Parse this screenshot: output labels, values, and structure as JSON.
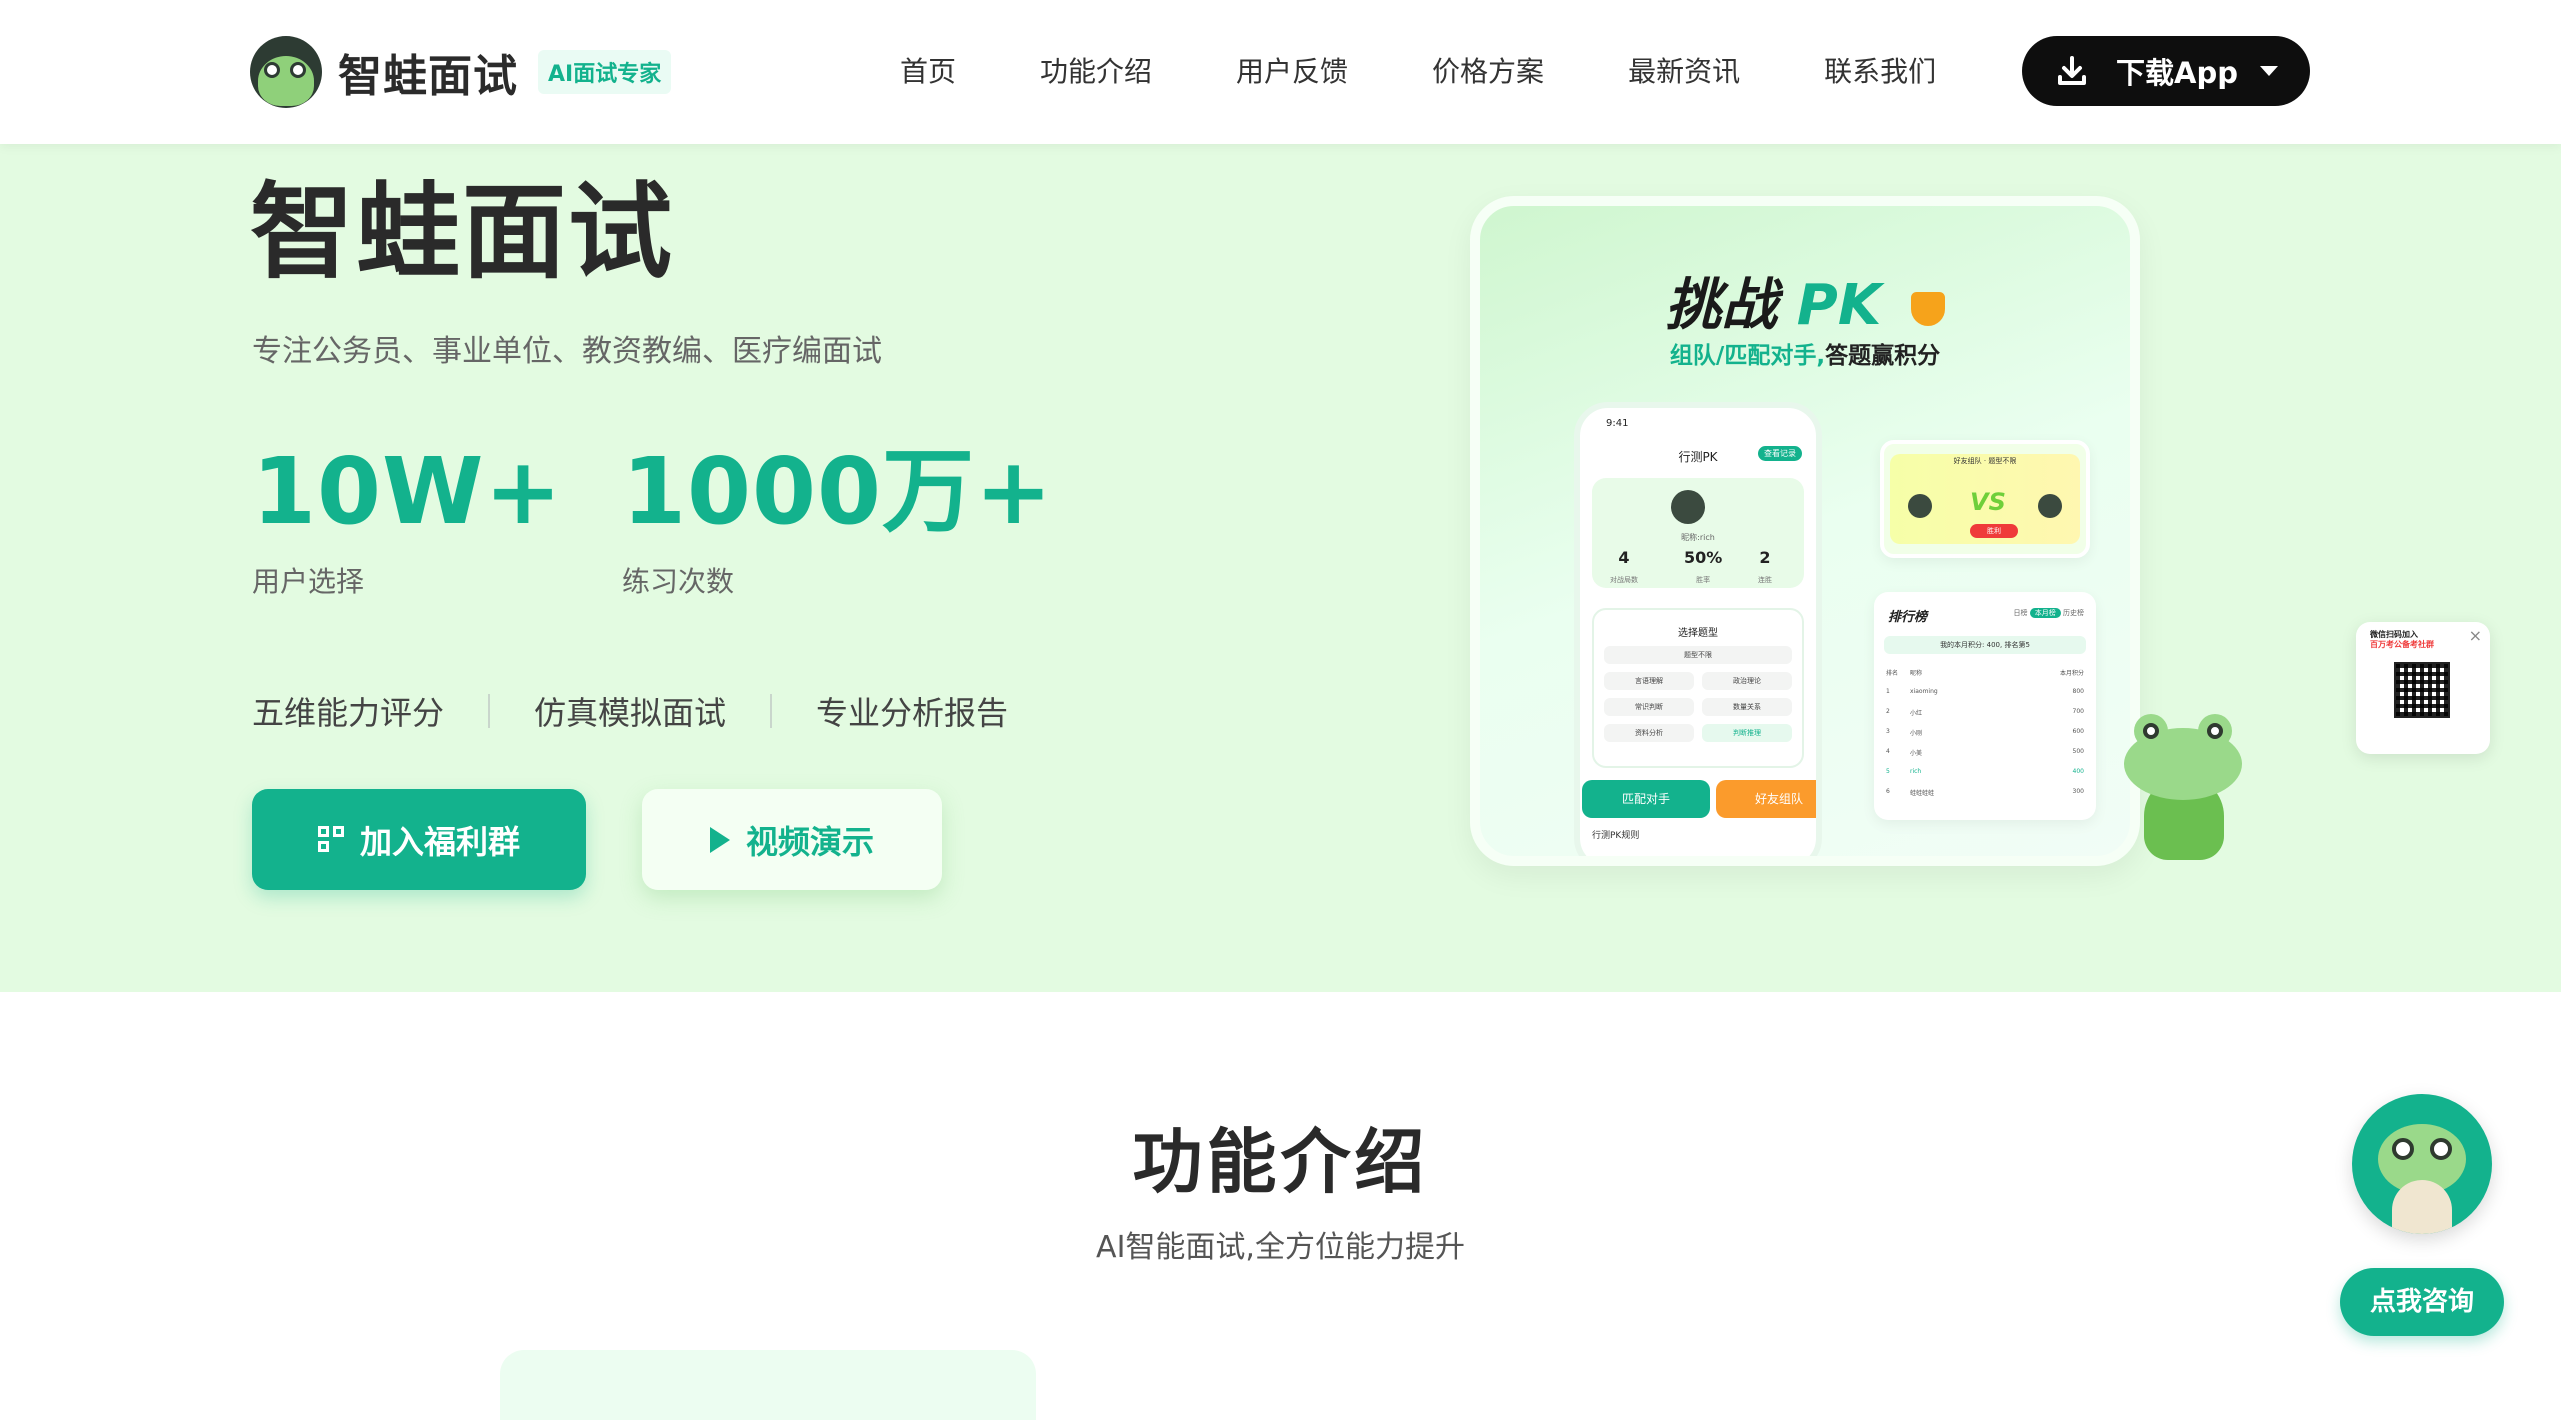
{
  "brand": {
    "name": "智蛙面试",
    "tag": "AI面试专家",
    "accent": "#13b28d"
  },
  "nav": {
    "items": [
      "首页",
      "功能介绍",
      "用户反馈",
      "价格方案",
      "最新资讯",
      "联系我们"
    ],
    "download_label": "下载App"
  },
  "hero": {
    "title": "智蛙面试",
    "subtitle": "专注公务员、事业单位、教资教编、医疗编面试",
    "stats": [
      {
        "value": "10W+",
        "label": "用户选择"
      },
      {
        "value": "1000万+",
        "label": "练习次数"
      }
    ],
    "features": [
      "五维能力评分",
      "仿真模拟面试",
      "专业分析报告"
    ],
    "primary_button": "加入福利群",
    "secondary_button": "视频演示"
  },
  "showcase": {
    "title_prefix": "挑战",
    "title_pk": "PK",
    "subtitle_green": "组队/匹配对手,",
    "subtitle_dark": "答题赢积分",
    "phone": {
      "time": "9:41",
      "title": "行测PK",
      "badge": "查看记录",
      "nickname": "昵称:rich",
      "stats": [
        {
          "value": "4",
          "label": "对战局数"
        },
        {
          "value": "50%",
          "label": "胜率"
        },
        {
          "value": "2",
          "label": "连胜"
        }
      ],
      "select_title": "选择题型",
      "chips": [
        "题型不限",
        "言语理解",
        "政治理论",
        "常识判断",
        "数量关系",
        "资料分析",
        "判断推理"
      ],
      "match_button": "匹配对手",
      "team_button": "好友组队",
      "rules": "行测PK规则"
    },
    "vs_card": {
      "title": "好友组队 · 题型不限",
      "vs": "VS",
      "result": "胜利"
    },
    "rank_card": {
      "title": "排行榜",
      "tabs": [
        "日榜",
        "本月榜",
        "历史榜"
      ],
      "mine": "我的本月积分: 400, 排名第5",
      "headers": [
        "排名",
        "昵称",
        "本月积分"
      ],
      "rows": [
        {
          "rank": "1",
          "name": "xiaoming",
          "score": "800"
        },
        {
          "rank": "2",
          "name": "小红",
          "score": "700"
        },
        {
          "rank": "3",
          "name": "小刚",
          "score": "600"
        },
        {
          "rank": "4",
          "name": "小美",
          "score": "500"
        },
        {
          "rank": "5",
          "name": "rich",
          "score": "400"
        },
        {
          "rank": "6",
          "name": "蛙蛙蛙蛙",
          "score": "300"
        }
      ]
    }
  },
  "qr_float": {
    "line1": "微信扫码加入",
    "line2": "百万考公备考社群"
  },
  "section": {
    "title": "功能介绍",
    "subtitle": "AI智能面试,全方位能力提升"
  },
  "consult": {
    "label": "点我咨询"
  }
}
